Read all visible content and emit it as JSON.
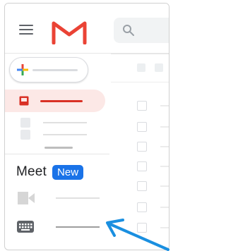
{
  "app": {
    "name": "Gmail",
    "logo_icon": "gmail-m-logo",
    "colors": {
      "logo_red": "#ea4335",
      "inbox_active_bg": "#fce8e6",
      "inbox_active_accent": "#d93025",
      "new_badge_bg": "#1a73e8",
      "arrow": "#1a8fe0"
    }
  },
  "header": {
    "menu_icon": "hamburger-menu-icon",
    "search_icon": "search-icon"
  },
  "sidebar": {
    "compose_icon": "plus-icon",
    "inbox_icon": "inbox-icon",
    "meet": {
      "title": "Meet",
      "badge": "New",
      "items": [
        {
          "icon": "video-camera-icon"
        },
        {
          "icon": "keyboard-icon"
        }
      ]
    }
  },
  "annotation": {
    "icon": "pointer-arrow-icon",
    "points_to": "keyboard-icon"
  }
}
